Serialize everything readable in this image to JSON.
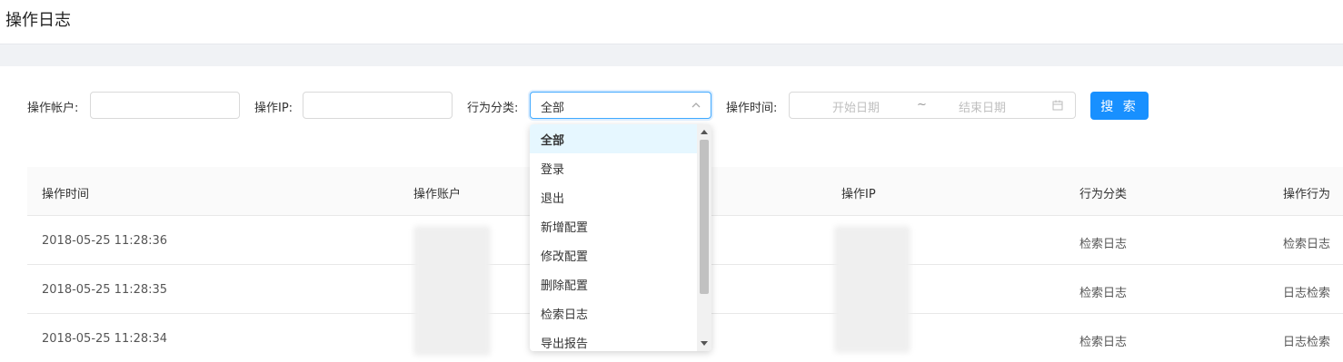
{
  "page": {
    "title": "操作日志"
  },
  "filters": {
    "account_label": "操作帐户:",
    "account_value": "",
    "ip_label": "操作IP:",
    "ip_value": "",
    "category_label": "行为分类:",
    "category_value": "全部",
    "time_label": "操作时间:",
    "start_placeholder": "开始日期",
    "separator": "~",
    "end_placeholder": "结束日期",
    "search_label": "搜 索"
  },
  "dropdown": {
    "options": [
      "全部",
      "登录",
      "退出",
      "新增配置",
      "修改配置",
      "删除配置",
      "检索日志",
      "导出报告"
    ],
    "selected": "全部"
  },
  "table": {
    "columns": [
      "操作时间",
      "操作账户",
      "操作IP",
      "行为分类",
      "操作行为"
    ],
    "rows": [
      {
        "time": "2018-05-25 11:28:36",
        "category": "检索日志",
        "action": "检索日志"
      },
      {
        "time": "2018-05-25 11:28:35",
        "category": "检索日志",
        "action": "日志检索"
      },
      {
        "time": "2018-05-25 11:28:34",
        "category": "检索日志",
        "action": "日志检索"
      }
    ]
  },
  "colors": {
    "primary": "#1890ff",
    "focus_border": "#40a9ff",
    "active_option_bg": "#e6f7ff"
  },
  "icons": {
    "select_arrow": "chevron-up-icon",
    "calendar": "calendar-icon"
  }
}
